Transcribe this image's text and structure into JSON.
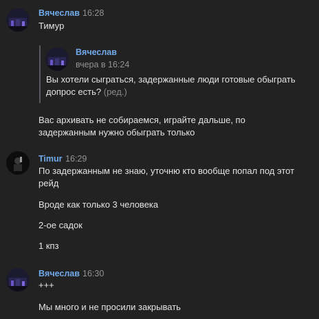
{
  "messages": [
    {
      "author": "Вячеслав",
      "time": "16:28",
      "lines": [
        "Тимур"
      ],
      "reply": {
        "author": "Вячеслав",
        "time": "вчера в 16:24",
        "lines": [
          "Вы хотели сыграться, задержанные люди готовые обыграть",
          "допрос есть?"
        ],
        "edited": "(ред.)"
      },
      "after_reply": [
        "Вас архивать не собираемся, играйте дальше, по",
        "задержанным нужно обыграть только"
      ]
    },
    {
      "author": "Timur",
      "time": "16:29",
      "paragraphs": [
        [
          "По задержанным не знаю, уточню кто вообще попал под этот",
          "рейд"
        ],
        [
          "Вроде как только 3 человека"
        ],
        [
          "2-ое садок"
        ],
        [
          "1 кпз"
        ]
      ]
    },
    {
      "author": "Вячеслав",
      "time": "16:30",
      "paragraphs": [
        [
          "+++"
        ],
        [
          "Мы много и не просили закрывать"
        ]
      ]
    }
  ],
  "colors": {
    "background": "#222222",
    "author": "#71aaeb",
    "time": "#939393",
    "text": "#e1e3e6"
  }
}
